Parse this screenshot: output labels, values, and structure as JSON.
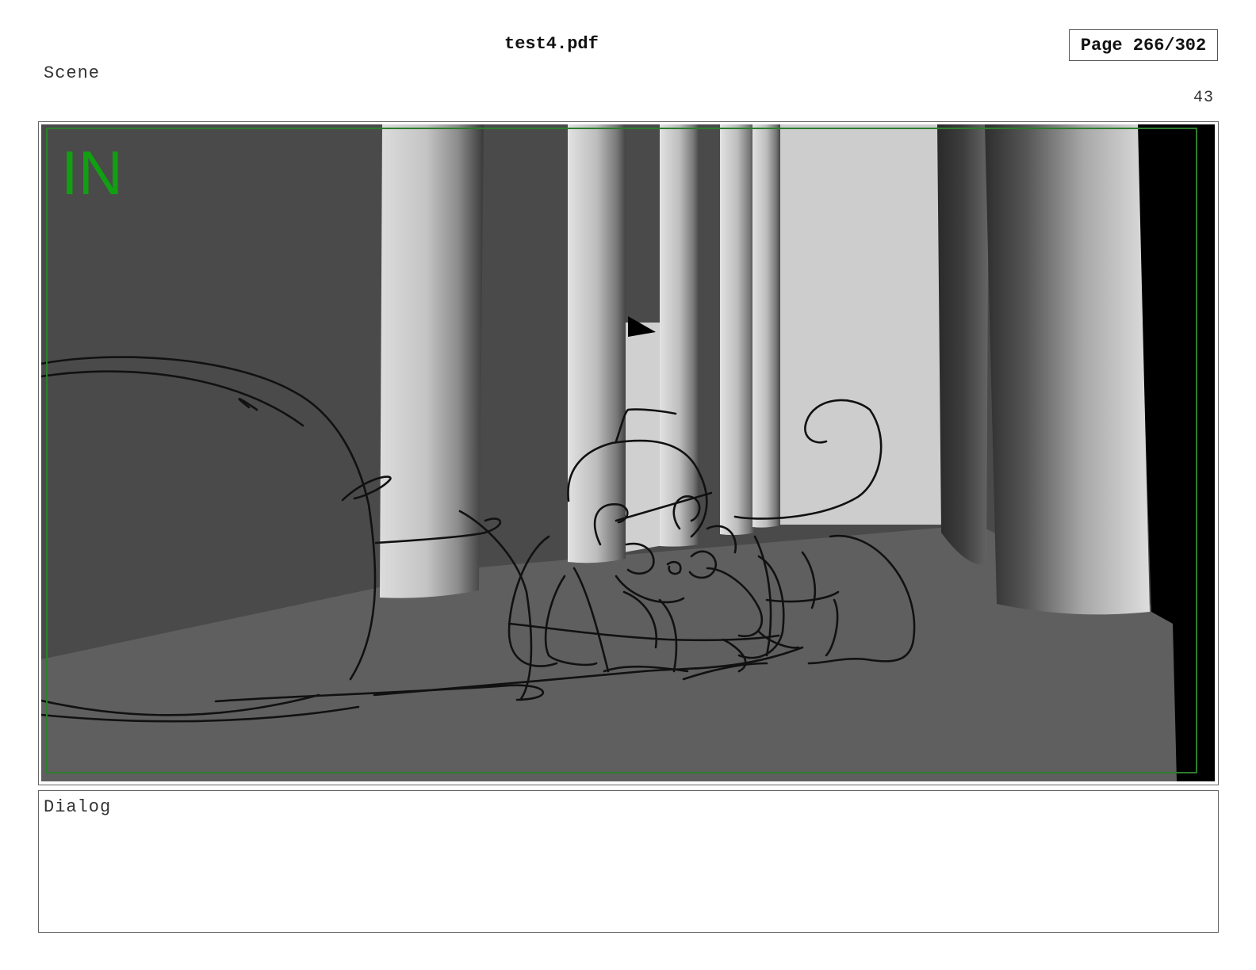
{
  "header": {
    "document_title": "test4.pdf",
    "page_indicator": "Page 266/302"
  },
  "scene": {
    "label": "Scene",
    "number": "43"
  },
  "panel": {
    "marker_text": "IN",
    "marker_color": "#11a011",
    "safe_frame_color": "#2e7d2e"
  },
  "dialog": {
    "label": "Dialog",
    "text": ""
  }
}
